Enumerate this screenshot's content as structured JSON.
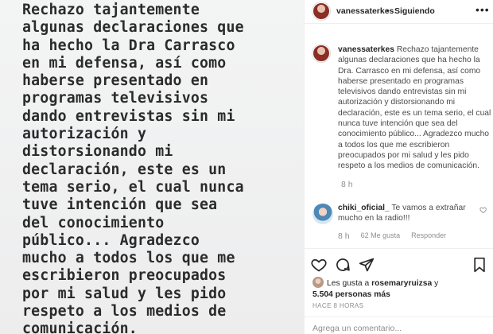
{
  "post": {
    "image_text": "Rechazo tajantemente\nalgunas declaraciones que\nha hecho la Dra Carrasco\nen mi defensa, así como\nhaberse presentado en\nprogramas televisivos\ndando entrevistas sin mi\nautorización y\ndistorsionando mi\ndeclaración, este es un\ntema serio, el cual nunca\ntuve intención que sea\ndel conocimiento\npúblico... Agradezco\nmucho a todos los que me\nescribieron preocupados\npor mi salud y les pido\nrespeto a los medios de\ncomunicación."
  },
  "header": {
    "username": "vanessaterkes",
    "separator": "•",
    "follow_label": "Siguiendo",
    "more_label": "•••"
  },
  "caption": {
    "username": "vanessaterkes",
    "text": "Rechazo tajantemente algunas declaraciones que ha hecho la Dra. Carrasco en mi defensa, así como haberse presentado en programas televisivos dando entrevistas sin mi autorización y distorsionando mi declaración, este es un tema serio, el cual nunca tuve intención que sea del conocimiento público... Agradezco mucho a todos los que me escribieron preocupados por mi salud y les pido respeto a los medios de comunicación.",
    "time": "8 h"
  },
  "comment": {
    "username": "chiki_oficial_",
    "text": "Te vamos a extrañar mucho en la radio!!!",
    "time": "8 h",
    "likes": "62 Me gusta",
    "reply_label": "Responder"
  },
  "actions": {
    "like_icon": "heart-icon",
    "comment_icon": "comment-icon",
    "share_icon": "share-icon",
    "save_icon": "bookmark-icon"
  },
  "likes": {
    "prefix": "Les gusta a ",
    "user": "rosemaryruizsa",
    "suffix": " y",
    "count_text": "5.504 personas más"
  },
  "time_ago": "HACE 8 HORAS",
  "add_comment": {
    "placeholder": "Agrega un comentario..."
  }
}
